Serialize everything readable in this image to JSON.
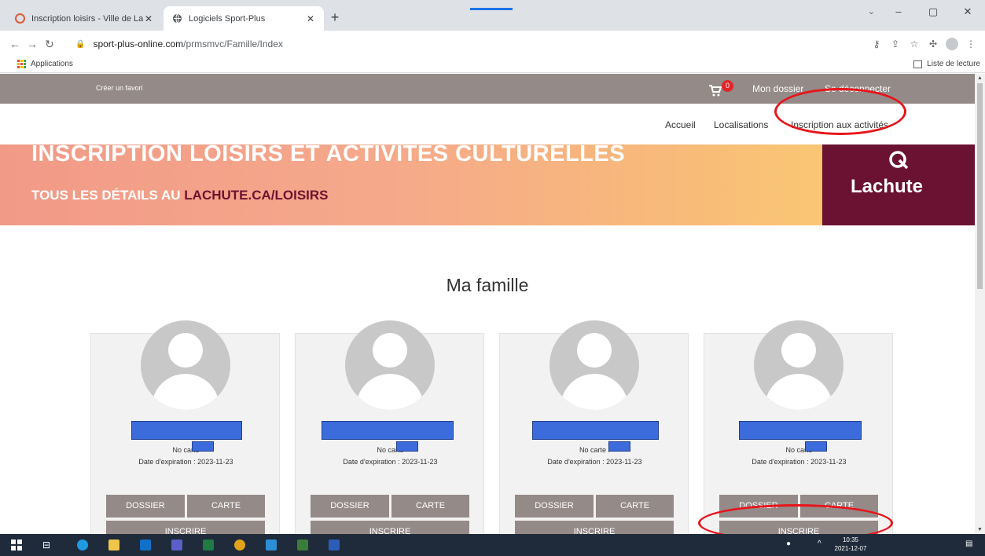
{
  "browser": {
    "tabs": [
      {
        "title": "Inscription loisirs - Ville de Lachu",
        "close": "✕"
      },
      {
        "title": "Logiciels Sport-Plus",
        "close": "✕"
      }
    ],
    "new_tab": "+",
    "window_controls": {
      "minimize": "–",
      "maximize": "▢",
      "close": "✕"
    },
    "tab_menu": "⌄",
    "url_domain": "sport-plus-online.com",
    "url_path": "/prmsmvc/Famille/Index",
    "bookmarks": {
      "apps": "Applications",
      "reading_list": "Liste de lecture"
    }
  },
  "site": {
    "topbar": {
      "favorite": "Créer un favori",
      "cart_count": "0",
      "my_account": "Mon dossier",
      "logout": "Se déconnecter"
    },
    "nav": [
      {
        "label": "Accueil"
      },
      {
        "label": "Localisations"
      },
      {
        "label": "Inscription aux activités"
      }
    ],
    "banner": {
      "headline": "INSCRIPTION LOISIRS ET ACTIVITÉS CULTURELLES",
      "sub_prefix": "TOUS LES DÉTAILS AU",
      "sub_link": "LACHUTE.CA/LOISIRS",
      "brand": "Lachute"
    },
    "section_title": "Ma famille",
    "members": [
      {
        "card_label": "No carte",
        "expiry": "Date d'expiration : 2023-11-23",
        "btn_file": "DOSSIER",
        "btn_card": "CARTE",
        "btn_register": "INSCRIRE"
      },
      {
        "card_label": "No carte",
        "expiry": "Date d'expiration : 2023-11-23",
        "btn_file": "DOSSIER",
        "btn_card": "CARTE",
        "btn_register": "INSCRIRE"
      },
      {
        "card_label": "No carte :",
        "expiry": "Date d'expiration : 2023-11-23",
        "btn_file": "DOSSIER",
        "btn_card": "CARTE",
        "btn_register": "INSCRIRE"
      },
      {
        "card_label": "No carte",
        "expiry": "Date d'expiration : 2023-11-23",
        "btn_file": "DOSSIER",
        "btn_card": "CARTE",
        "btn_register": "INSCRIRE"
      }
    ]
  },
  "taskbar": {
    "time": "10:35",
    "date": "2021-12-07"
  },
  "colors": {
    "topbar": "#948a88",
    "button": "#948a88",
    "brand": "#6b1232",
    "annotation": "#e8141a",
    "redaction": "#3c6bdb"
  }
}
